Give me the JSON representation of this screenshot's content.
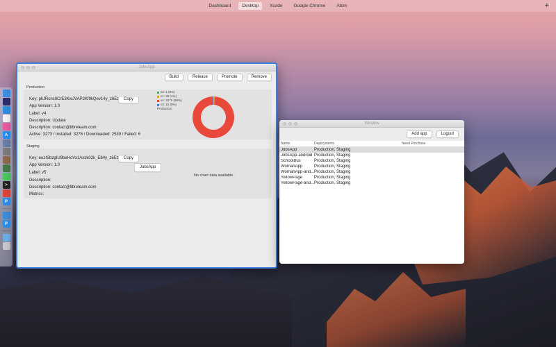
{
  "topbar": {
    "tabs": [
      "Dashboard",
      "Desktop",
      "Xcode",
      "Google Chrome",
      "Atom"
    ],
    "active_index": 1,
    "plus": "+"
  },
  "dock": {
    "items": [
      {
        "icon": "finder-icon",
        "color": "#3e8fe8",
        "glyph": ""
      },
      {
        "icon": "siri-icon",
        "color": "#2b2d6b",
        "glyph": ""
      },
      {
        "icon": "safari-icon",
        "color": "#2f8ee0",
        "glyph": ""
      },
      {
        "icon": "calendar-icon",
        "color": "#f4f4f4",
        "glyph": ""
      },
      {
        "icon": "itunes-icon",
        "color": "#e85ea3",
        "glyph": ""
      },
      {
        "icon": "app-store-icon",
        "color": "#2a8ff0",
        "glyph": "A"
      },
      {
        "icon": "preview-icon",
        "color": "#6a7fa8",
        "glyph": ""
      },
      {
        "icon": "system-preferences-icon",
        "color": "#7c7c7c",
        "glyph": ""
      },
      {
        "icon": "photos-icon",
        "color": "#8f6b4a",
        "glyph": ""
      },
      {
        "icon": "maps-icon",
        "color": "#4a7a4a",
        "glyph": ""
      },
      {
        "icon": "messages-icon",
        "color": "#4cc95c",
        "glyph": ""
      },
      {
        "icon": "terminal-icon",
        "color": "#222222",
        "glyph": ">"
      },
      {
        "icon": "chrome-icon",
        "color": "#e0453a",
        "glyph": ""
      },
      {
        "icon": "pycharm-icon",
        "color": "#2d8fe8",
        "glyph": "P"
      },
      {
        "icon": "xcode-icon",
        "color": "#3b8fe0",
        "glyph": ""
      },
      {
        "icon": "pycharm-icon-2",
        "color": "#2d8fe8",
        "glyph": "P"
      },
      {
        "icon": "folder-icon",
        "color": "#6fb0ea",
        "glyph": ""
      },
      {
        "icon": "trash-icon",
        "color": "#c9c9cf",
        "glyph": ""
      }
    ]
  },
  "jobsapp": {
    "title": "JobsApp",
    "toolbar": {
      "build": "Build",
      "release": "Release",
      "promote": "Promote",
      "remove": "Remove"
    },
    "production": {
      "label": "Production",
      "key": "Key: pkJRcnsIICrE3KwJVAP2Kf9kQev14y_z6EzyQ",
      "copy": "Copy",
      "app_version": "App Version: 1.0",
      "app_label": "Label: v4",
      "description": "Description: Update",
      "description2": "Description: contact@libreteam.com",
      "stats": "Active: 3273 / Installed: 3276 / Downloaded: 2539 / Failed: 6",
      "chart_caption": "Production"
    },
    "staging": {
      "label": "Staging",
      "key": "Key: euzISbzgIU9beHcVx1Axzk02k_E84y_z6EzyQ",
      "copy": "Copy",
      "app_version": "App Version: 1.0",
      "app_label": "Label: v5",
      "description": "Description:",
      "description2": "Description: contact@libreteam.com",
      "metrics": "Metrics:",
      "jobsapp_button": "JobsApp",
      "no_chart": "No chart data available."
    }
  },
  "chart_data": {
    "type": "pie",
    "title": "",
    "labels": [
      "v2: 1 (0%)",
      "v1: 35 (1%)",
      "v4: 3276 (98%)",
      "v3: 15 (0%)"
    ],
    "values": [
      1,
      35,
      3276,
      15
    ],
    "colors": [
      "#4caf50",
      "#e0a12a",
      "#e8493a",
      "#4a7cd6"
    ],
    "donut": true
  },
  "window2": {
    "title": "Window",
    "add_app": "Add app",
    "logout": "Logout",
    "columns": [
      "Name",
      "Deployments",
      "Need Purchase"
    ],
    "rows": [
      {
        "name": "JobsApp",
        "deployments": "Production, Staging",
        "purchase": ""
      },
      {
        "name": "JobsApp-android",
        "deployments": "Production, Staging",
        "purchase": ""
      },
      {
        "name": "SchoolBus",
        "deployments": "Production, Staging",
        "purchase": ""
      },
      {
        "name": "WomanApp",
        "deployments": "Production, Staging",
        "purchase": ""
      },
      {
        "name": "WomanApp-and...",
        "deployments": "Production, Staging",
        "purchase": ""
      },
      {
        "name": "YellowPage",
        "deployments": "Production, Staging",
        "purchase": ""
      },
      {
        "name": "YellowPage-and...",
        "deployments": "Production, Staging",
        "purchase": ""
      }
    ],
    "selected_index": 0
  }
}
